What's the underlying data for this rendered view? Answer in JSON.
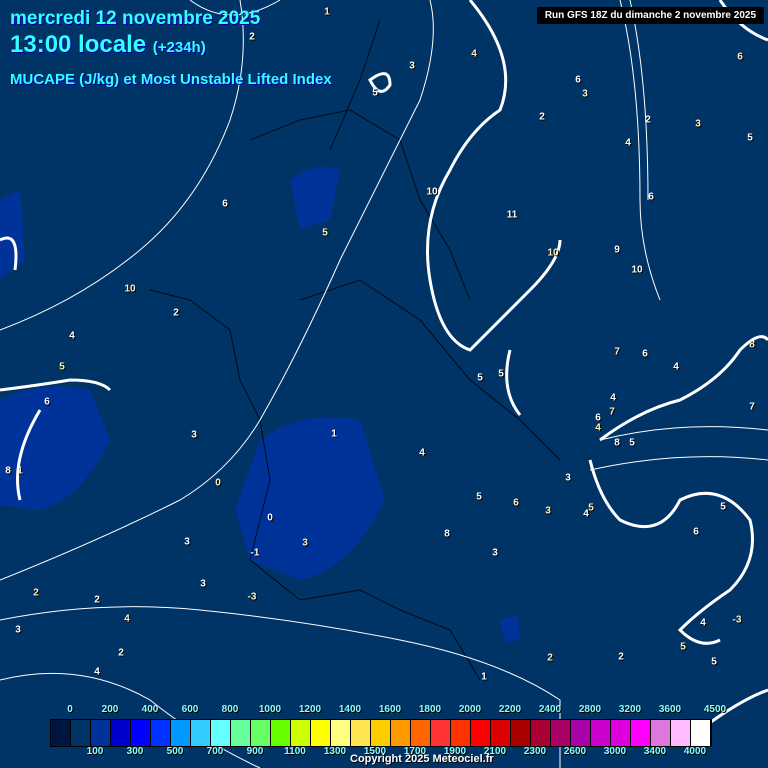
{
  "header": {
    "date": "mercredi 12 novembre 2025",
    "time": "13:00 locale",
    "lead": "(+234h)",
    "parameter": "MUCAPE (J/kg) et Most Unstable Lifted Index",
    "run": "Run GFS 18Z du dimanche 2 novembre 2025"
  },
  "colorbar": {
    "colors": [
      "#001540",
      "#003366",
      "#003399",
      "#0000cc",
      "#0000ff",
      "#0033ff",
      "#0099ff",
      "#33ccff",
      "#66ffff",
      "#66ff99",
      "#66ff66",
      "#66ff00",
      "#ccff00",
      "#ffff00",
      "#ffff80",
      "#ffe650",
      "#ffcc00",
      "#ff9900",
      "#ff6600",
      "#ff3333",
      "#ff3300",
      "#ff0000",
      "#dd0000",
      "#aa0000",
      "#aa0033",
      "#aa0066",
      "#aa00aa",
      "#cc00cc",
      "#dd00dd",
      "#ff00ff",
      "#dd77dd",
      "#ffbbff",
      "#ffffff"
    ],
    "top_labels": [
      "0",
      "200",
      "400",
      "600",
      "800",
      "1000",
      "1200",
      "1400",
      "1600",
      "1800",
      "2000",
      "2200",
      "2400",
      "2800",
      "3200",
      "3600",
      "4500"
    ],
    "bottom_labels": [
      "100",
      "300",
      "500",
      "700",
      "900",
      "1100",
      "1300",
      "1500",
      "1700",
      "1900",
      "2100",
      "2300",
      "2600",
      "3000",
      "3400",
      "4000"
    ]
  },
  "contour_labels": [
    "1",
    "2",
    "3",
    "4",
    "5",
    "6",
    "3",
    "2",
    "2",
    "3",
    "5",
    "4",
    "6",
    "6",
    "6",
    "5",
    "10",
    "11",
    "10",
    "9",
    "10",
    "10",
    "2",
    "4",
    "5",
    "6",
    "8",
    "1",
    "3",
    "1",
    "0",
    "0",
    "-1",
    "3",
    "3",
    "3",
    "2",
    "2",
    "3",
    "4",
    "4",
    "2",
    "-3",
    "4",
    "5",
    "6",
    "8",
    "3",
    "3",
    "3",
    "4",
    "5",
    "4",
    "6",
    "7",
    "8",
    "5",
    "4",
    "5",
    "5",
    "7",
    "6",
    "4",
    "8",
    "7",
    "4",
    "2",
    "2",
    "1",
    "5",
    "5",
    "5",
    "-3",
    "6"
  ],
  "copyright": "Copyright 2025 Meteociel.fr",
  "colors": {
    "title": "#33ffff",
    "background": "#003366",
    "cape_low": "#003399"
  }
}
